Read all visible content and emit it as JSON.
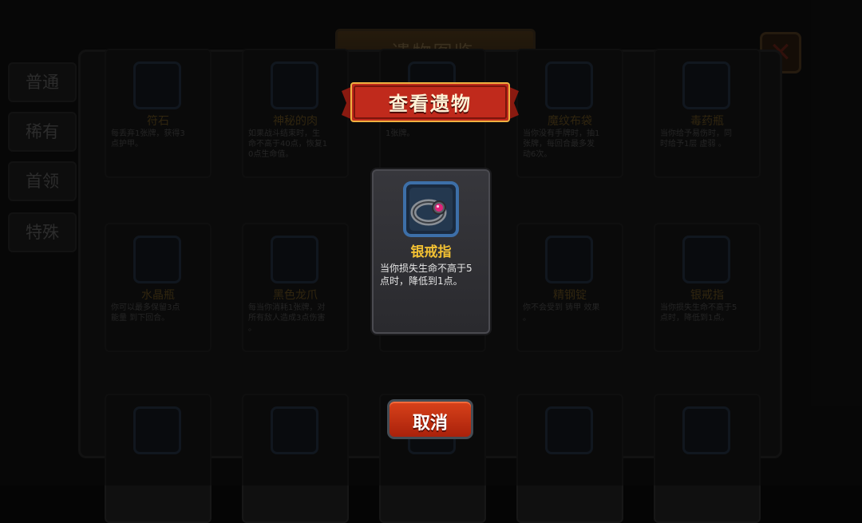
{
  "background": {
    "title": "遗物图鉴",
    "close_label": "✕",
    "tabs": [
      "普通",
      "稀有",
      "首领",
      "特殊"
    ],
    "cards": [
      {
        "name": "符石",
        "desc": "每丢弃1张牌，获得3\n点护甲。"
      },
      {
        "name": "神秘的肉",
        "desc": "如果战斗结束时，生\n命不高于40点，恢复1\n0点生命值。"
      },
      {
        "name": "",
        "desc": "1张牌。"
      },
      {
        "name": "魔纹布袋",
        "desc": "当你没有手牌时，抽1\n张牌，每回合最多发\n动6次。"
      },
      {
        "name": "毒药瓶",
        "desc": "当你给予易伤时，同\n时给予1层 虚弱 。"
      },
      {
        "name": "水晶瓶",
        "desc": "你可以最多保留3点\n能量 到下回合。"
      },
      {
        "name": "黑色龙爪",
        "desc": "每当你消耗1张牌，对\n所有敌人造成3点伤害\n。"
      },
      {
        "name": "",
        "desc": ""
      },
      {
        "name": "精钢锭",
        "desc": "你不会受到 铸甲 效果\n。"
      },
      {
        "name": "银戒指",
        "desc": "当你损失生命不高于5\n点时，降低到1点。"
      },
      {
        "name": "",
        "desc": ""
      },
      {
        "name": "",
        "desc": ""
      },
      {
        "name": "",
        "desc": ""
      },
      {
        "name": "",
        "desc": ""
      },
      {
        "name": "",
        "desc": ""
      }
    ]
  },
  "dialog": {
    "banner_title": "查看遗物",
    "relic_icon": "silver-ring-icon",
    "relic_name": "银戒指",
    "relic_desc": "当你损失生命不高于5\n点时，降低到1点。",
    "cancel_label": "取消"
  },
  "colors": {
    "banner_red": "#c02a1c",
    "relic_name_gold": "#f2c033",
    "cancel_orange": "#d8421a"
  }
}
